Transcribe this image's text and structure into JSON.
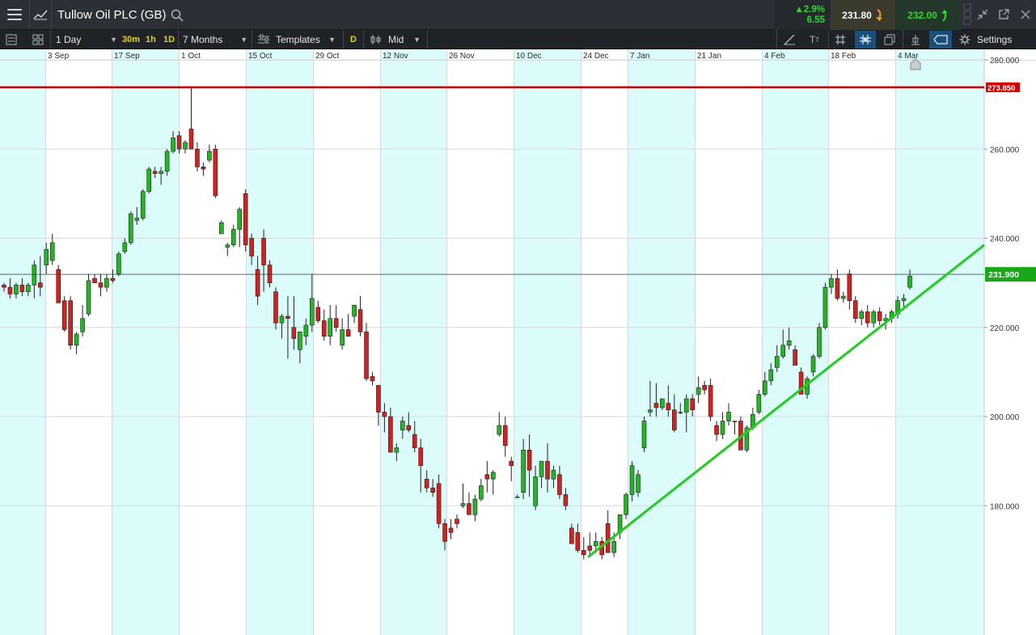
{
  "header": {
    "instrument": "Tullow Oil PLC (GB)",
    "change_pct": "▲2.9%",
    "change_abs": "6.55",
    "sell_price": "231.80",
    "buy_price": "232.00"
  },
  "toolbar": {
    "interval": "1 Day",
    "quick_30m": "30m",
    "quick_1h": "1h",
    "quick_1d": "1D",
    "range": "7 Months",
    "templates": "Templates",
    "d_badge": "D",
    "price_type": "Mid",
    "settings": "Settings"
  },
  "colors": {
    "up": "#26b426",
    "down": "#d12222",
    "band": "#dcfcfc",
    "hline": "#d00000",
    "trend": "#22cc22",
    "current": "#1aa81a"
  },
  "chart_data": {
    "type": "candlestick",
    "x_labels": [
      "3 Sep",
      "17 Sep",
      "1 Oct",
      "15 Oct",
      "29 Oct",
      "12 Nov",
      "26 Nov",
      "10 Dec",
      "24 Dec",
      "7 Jan",
      "21 Jan",
      "4 Feb",
      "18 Feb",
      "4 Mar"
    ],
    "y_ticks": [
      "280.000",
      "260.000",
      "240.000",
      "220.000",
      "200.000",
      "180.000"
    ],
    "y_tick_values": [
      280,
      260,
      240,
      220,
      200,
      180
    ],
    "resistance_label": "273.850",
    "resistance_value": 273.85,
    "current_label": "231.900",
    "current_value": 231.9,
    "trendline": {
      "from": {
        "date": "27 Dec",
        "price": 168.5
      },
      "to": {
        "date": "13 Mar",
        "price": 238.5
      }
    },
    "candles": [
      [
        229.5,
        230.0,
        228.0,
        229.0
      ],
      [
        229.0,
        231.0,
        226.5,
        227.5
      ],
      [
        227.5,
        230.0,
        226.5,
        229.5
      ],
      [
        229.5,
        231.0,
        227.0,
        228.0
      ],
      [
        228.0,
        230.0,
        227.0,
        229.5
      ],
      [
        229.5,
        235.0,
        226.5,
        234.0
      ],
      [
        230.0,
        236.0,
        227.0,
        229.0
      ],
      [
        234.0,
        239.0,
        232.0,
        237.5
      ],
      [
        235.0,
        241.0,
        234.0,
        239.0
      ],
      [
        233.0,
        234.0,
        226.0,
        225.5
      ],
      [
        226.0,
        227.0,
        219.0,
        219.5
      ],
      [
        226.0,
        227.0,
        215.0,
        216.0
      ],
      [
        216.0,
        219.0,
        214.0,
        218.5
      ],
      [
        219.0,
        225.0,
        218.0,
        222.0
      ],
      [
        223.0,
        232.0,
        222.5,
        230.5
      ],
      [
        231.0,
        232.0,
        230.0,
        230.0
      ],
      [
        230.0,
        232.0,
        227.0,
        229.0
      ],
      [
        229.0,
        232.0,
        228.0,
        231.0
      ],
      [
        231.0,
        233.0,
        230.0,
        230.5
      ],
      [
        232.0,
        237.0,
        231.5,
        236.5
      ],
      [
        237.0,
        240.0,
        236.5,
        239.0
      ],
      [
        239.0,
        246.0,
        238.5,
        245.5
      ],
      [
        244.0,
        247.0,
        243.0,
        244.5
      ],
      [
        244.5,
        251.0,
        244.0,
        250.5
      ],
      [
        250.5,
        256.0,
        250.0,
        255.5
      ],
      [
        255.0,
        256.0,
        253.5,
        254.5
      ],
      [
        254.5,
        256.0,
        252.0,
        255.0
      ],
      [
        255.0,
        260.0,
        254.0,
        259.5
      ],
      [
        259.5,
        264.0,
        259.0,
        262.5
      ],
      [
        263.0,
        264.0,
        259.0,
        260.0
      ],
      [
        260.0,
        262.0,
        259.0,
        261.5
      ],
      [
        264.5,
        274.0,
        262.0,
        260.0
      ],
      [
        260.0,
        261.5,
        255.0,
        256.0
      ],
      [
        256.0,
        257.0,
        254.0,
        255.5
      ],
      [
        257.5,
        261.0,
        257.0,
        259.5
      ],
      [
        260.0,
        261.0,
        249.0,
        249.5
      ],
      [
        241.0,
        244.0,
        241.0,
        243.5
      ],
      [
        238.0,
        239.0,
        236.0,
        238.5
      ],
      [
        238.5,
        243.0,
        238.0,
        242.0
      ],
      [
        242.0,
        247.0,
        238.0,
        246.5
      ],
      [
        250.0,
        251.0,
        237.0,
        238.5
      ],
      [
        240.0,
        241.0,
        234.0,
        236.0
      ],
      [
        233.0,
        236.0,
        225.0,
        227.0
      ],
      [
        240.0,
        242.0,
        228.0,
        234.0
      ],
      [
        234.0,
        235.0,
        229.0,
        230.0
      ],
      [
        228.0,
        229.0,
        219.5,
        221.0
      ],
      [
        221.0,
        223.0,
        217.5,
        222.5
      ],
      [
        222.5,
        227.0,
        213.0,
        222.0
      ],
      [
        220.0,
        227.0,
        215.0,
        217.5
      ],
      [
        215.0,
        216.0,
        212.0,
        219.0
      ],
      [
        218.0,
        222.0,
        216.0,
        220.5
      ],
      [
        220.5,
        232.0,
        219.0,
        226.5
      ],
      [
        224.5,
        226.0,
        221.0,
        221.5
      ],
      [
        221.5,
        224.0,
        217.0,
        218.0
      ],
      [
        218.0,
        225.0,
        216.0,
        222.0
      ],
      [
        222.0,
        225.0,
        219.0,
        220.0
      ],
      [
        216.0,
        222.0,
        215.0,
        219.5
      ],
      [
        219.5,
        223.0,
        218.0,
        218.0
      ],
      [
        222.5,
        225.0,
        221.0,
        225.0
      ],
      [
        224.0,
        227.0,
        218.0,
        219.0
      ],
      [
        219.0,
        221.0,
        208.0,
        208.5
      ],
      [
        209.0,
        210.0,
        207.0,
        208.0
      ],
      [
        207.0,
        207.0,
        198.0,
        201.0
      ],
      [
        201.0,
        203.0,
        196.5,
        200.0
      ],
      [
        200.0,
        202.0,
        193.0,
        192.0
      ],
      [
        192.0,
        194.0,
        190.0,
        193.0
      ],
      [
        197.0,
        200.0,
        195.0,
        199.0
      ],
      [
        198.0,
        201.0,
        196.5,
        197.0
      ],
      [
        196.0,
        199.0,
        192.0,
        193.0
      ],
      [
        193.0,
        195.0,
        183.0,
        189.0
      ],
      [
        186.0,
        188.0,
        183.0,
        184.0
      ],
      [
        184.0,
        186.0,
        182.0,
        183.0
      ],
      [
        185.0,
        187.0,
        175.0,
        176.0
      ],
      [
        176.0,
        177.0,
        170.0,
        172.0
      ],
      [
        175.0,
        177.0,
        172.5,
        174.0
      ],
      [
        177.0,
        178.0,
        175.0,
        176.0
      ],
      [
        180.0,
        185.0,
        179.5,
        180.5
      ],
      [
        180.5,
        183.0,
        178.0,
        178.0
      ],
      [
        178.0,
        182.5,
        176.5,
        181.5
      ],
      [
        181.5,
        186.0,
        181.0,
        184.5
      ],
      [
        187.0,
        190.0,
        183.0,
        186.0
      ],
      [
        186.0,
        188.0,
        182.5,
        187.5
      ],
      [
        196.0,
        201.0,
        195.5,
        198.0
      ],
      [
        198.0,
        200.0,
        191.0,
        193.5
      ],
      [
        190.0,
        191.0,
        185.5,
        189.0
      ],
      [
        182.0,
        182.5,
        182.0,
        182.0
      ],
      [
        183.0,
        195.0,
        181.5,
        192.5
      ],
      [
        192.5,
        196.0,
        182.0,
        188.0
      ],
      [
        180.0,
        189.0,
        179.0,
        186.5
      ],
      [
        186.5,
        190.0,
        184.0,
        190.0
      ],
      [
        190.0,
        194.0,
        183.0,
        186.0
      ],
      [
        186.0,
        189.0,
        184.0,
        188.0
      ],
      [
        187.0,
        189.0,
        181.5,
        182.5
      ],
      [
        182.5,
        184.0,
        179.0,
        180.0
      ],
      [
        175.0,
        176.0,
        171.5,
        171.5
      ],
      [
        174.0,
        176.0,
        169.5,
        170.0
      ],
      [
        170.0,
        173.0,
        168.0,
        169.0
      ],
      [
        171.0,
        174.0,
        169.0,
        170.0
      ],
      [
        171.0,
        174.0,
        169.5,
        172.0
      ],
      [
        172.0,
        173.0,
        168.0,
        169.0
      ],
      [
        176.0,
        179.0,
        172.0,
        169.5
      ],
      [
        169.5,
        174.0,
        168.5,
        172.0
      ],
      [
        174.0,
        177.5,
        172.5,
        178.0
      ],
      [
        178.0,
        183.0,
        177.0,
        182.5
      ],
      [
        182.5,
        190.0,
        181.0,
        189.0
      ],
      [
        183.0,
        188.0,
        182.0,
        187.0
      ],
      [
        193.0,
        200.0,
        192.0,
        199.0
      ],
      [
        201.0,
        208.0,
        200.0,
        201.5
      ],
      [
        203.0,
        207.5,
        200.0,
        202.0
      ],
      [
        202.0,
        204.0,
        201.5,
        204.0
      ],
      [
        203.0,
        207.0,
        200.0,
        201.5
      ],
      [
        201.5,
        205.0,
        196.5,
        197.0
      ],
      [
        201.0,
        203.0,
        200.5,
        201.0
      ],
      [
        201.0,
        205.0,
        196.5,
        204.0
      ],
      [
        204.0,
        205.0,
        200.0,
        201.5
      ],
      [
        205.0,
        209.0,
        203.0,
        206.5
      ],
      [
        207.0,
        208.0,
        205.0,
        206.0
      ],
      [
        207.0,
        208.5,
        199.0,
        200.0
      ],
      [
        198.0,
        199.0,
        194.5,
        196.0
      ],
      [
        196.0,
        201.0,
        195.0,
        199.0
      ],
      [
        199.0,
        203.0,
        198.0,
        201.0
      ],
      [
        199.0,
        199.0,
        196.0,
        199.0
      ],
      [
        199.0,
        200.0,
        192.5,
        192.5
      ],
      [
        192.5,
        198.0,
        192.0,
        197.5
      ],
      [
        197.5,
        202.0,
        197.0,
        200.5
      ],
      [
        201.0,
        206.0,
        200.5,
        205.0
      ],
      [
        205.0,
        210.0,
        204.5,
        208.0
      ],
      [
        208.0,
        212.0,
        207.0,
        210.5
      ],
      [
        211.0,
        216.0,
        210.0,
        213.5
      ],
      [
        213.5,
        219.5,
        213.0,
        216.0
      ],
      [
        216.0,
        220.0,
        215.0,
        217.0
      ],
      [
        215.0,
        216.0,
        212.0,
        211.5
      ],
      [
        210.0,
        211.0,
        206.0,
        205.0
      ],
      [
        205.0,
        209.0,
        204.0,
        208.5
      ],
      [
        210.0,
        214.0,
        209.0,
        213.5
      ],
      [
        213.5,
        221.0,
        213.0,
        220.0
      ],
      [
        220.0,
        230.0,
        219.5,
        229.0
      ],
      [
        229.0,
        232.0,
        227.5,
        231.0
      ],
      [
        231.0,
        233.0,
        226.0,
        226.5
      ],
      [
        226.5,
        228.0,
        225.5,
        227.0
      ],
      [
        232.0,
        233.0,
        224.0,
        226.0
      ],
      [
        226.0,
        227.0,
        221.0,
        222.0
      ],
      [
        222.0,
        224.0,
        220.5,
        223.5
      ],
      [
        223.5,
        225.0,
        220.0,
        221.0
      ],
      [
        221.0,
        224.0,
        220.0,
        223.5
      ],
      [
        223.5,
        224.5,
        220.5,
        221.5
      ],
      [
        221.5,
        223.0,
        219.5,
        222.0
      ],
      [
        222.0,
        224.0,
        221.0,
        223.5
      ],
      [
        223.0,
        227.0,
        222.0,
        226.0
      ],
      [
        226.0,
        227.5,
        224.0,
        226.5
      ],
      [
        229.0,
        233.0,
        228.5,
        231.5
      ]
    ]
  }
}
